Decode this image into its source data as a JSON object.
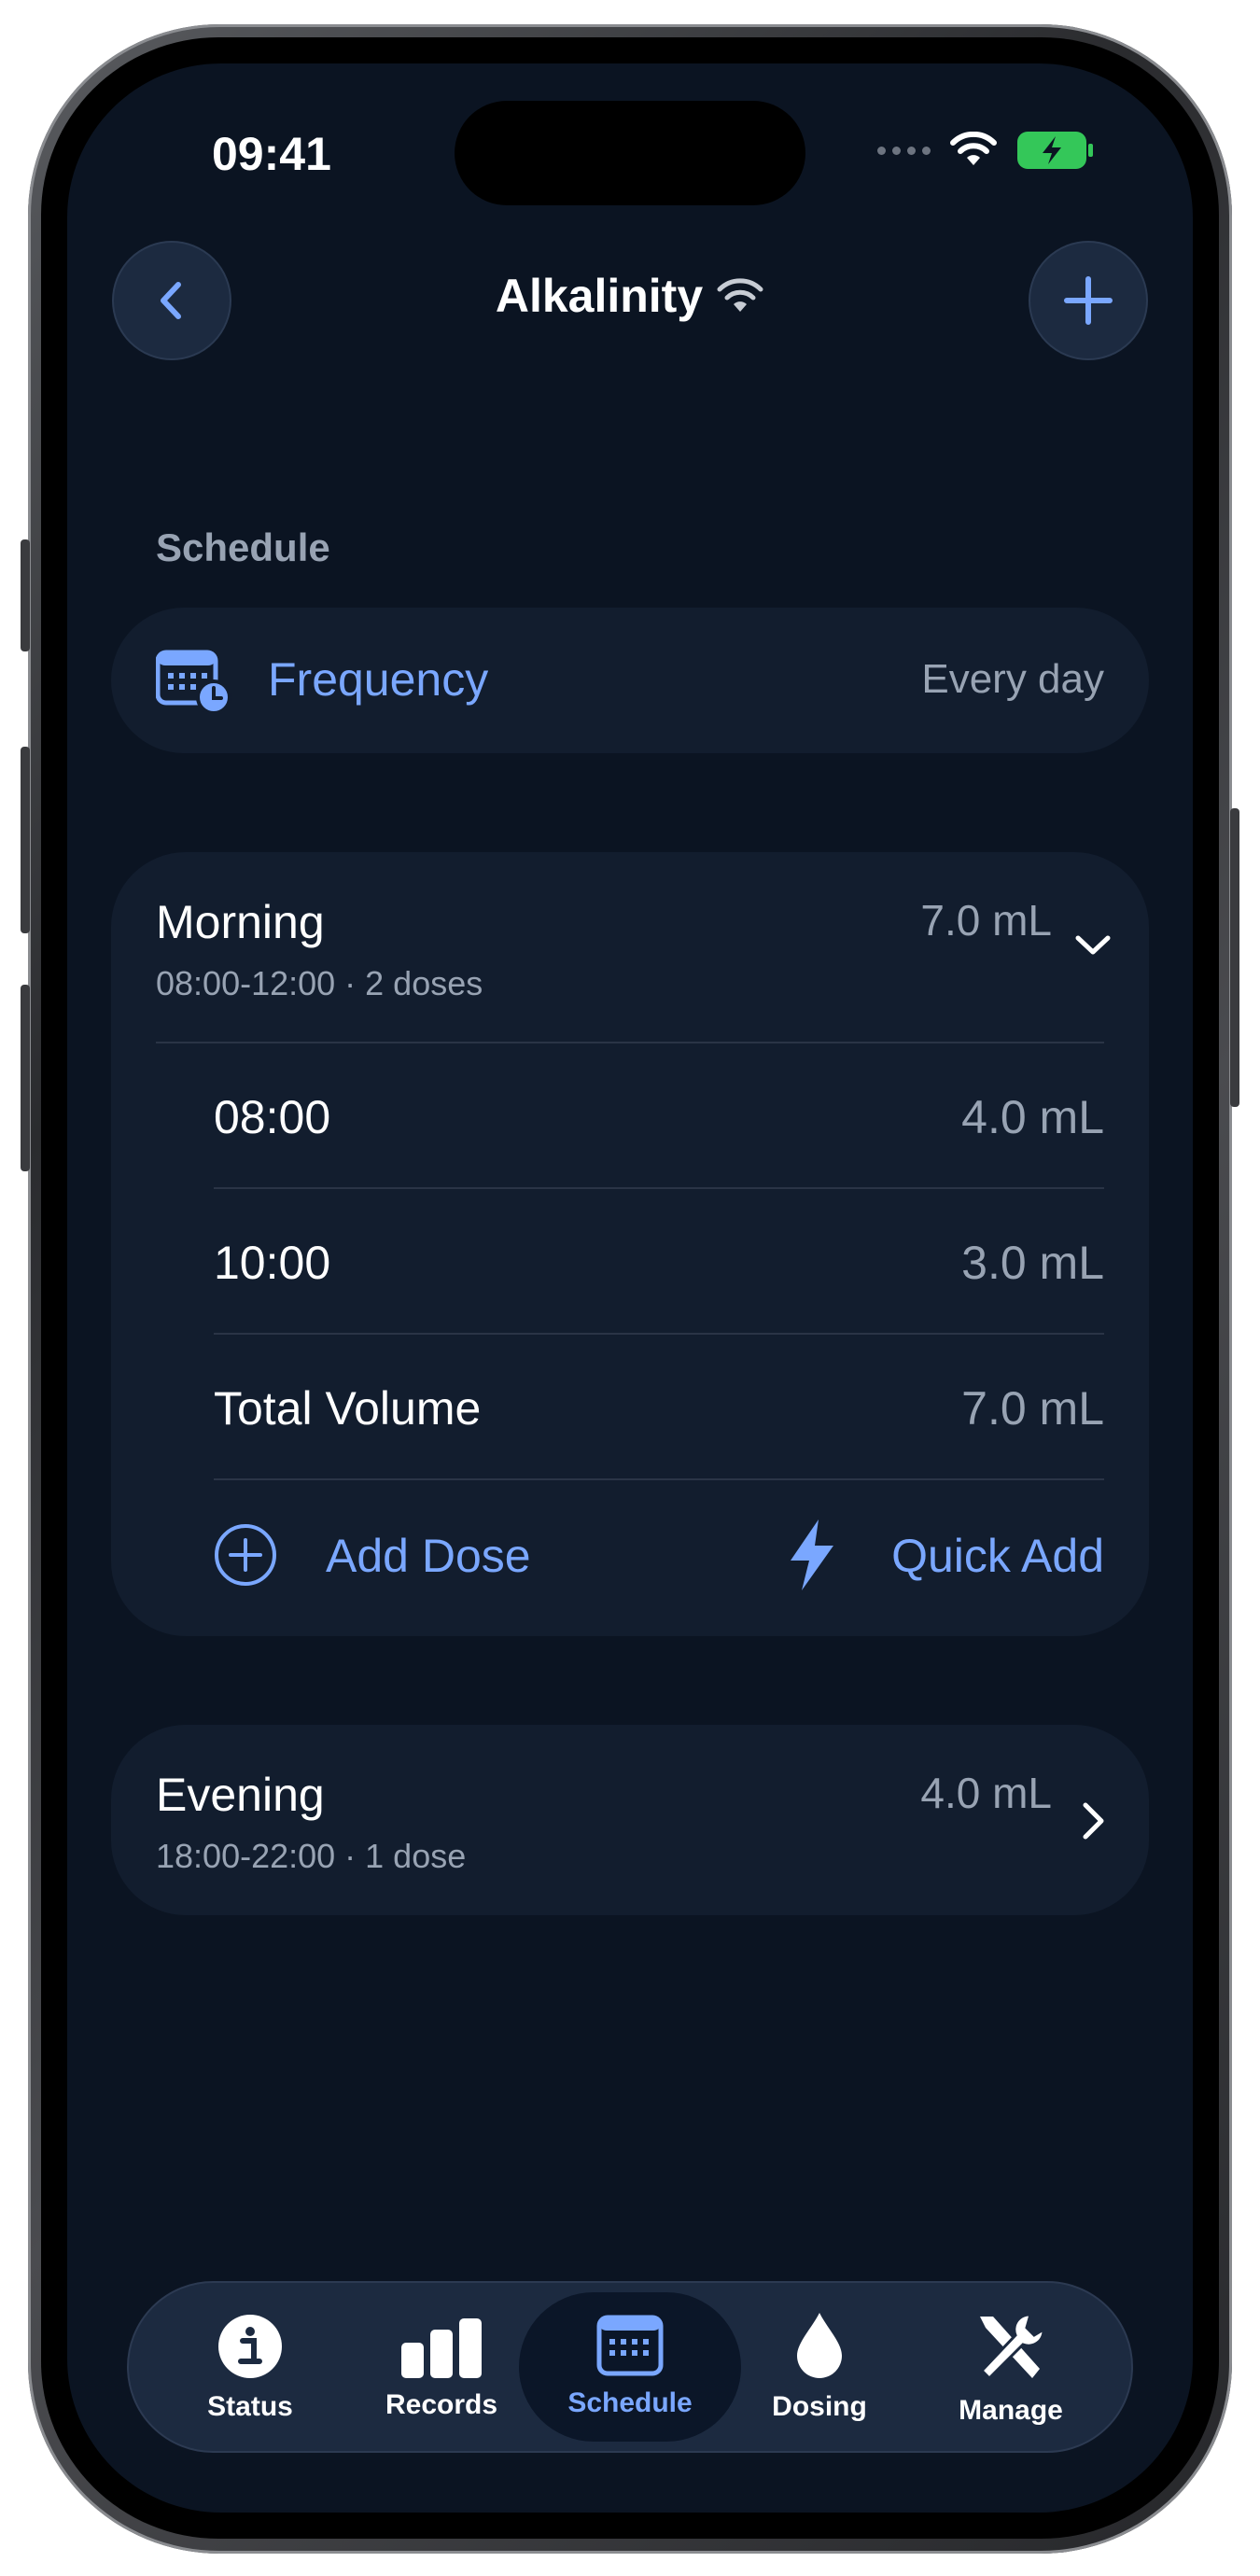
{
  "status_bar": {
    "time": "09:41"
  },
  "header": {
    "title": "Alkalinity"
  },
  "schedule": {
    "section_label": "Schedule",
    "frequency": {
      "label": "Frequency",
      "value": "Every day"
    }
  },
  "morning": {
    "name": "Morning",
    "subtitle": "08:00-12:00 · 2 doses",
    "total": "7.0 mL",
    "doses": [
      {
        "time": "08:00",
        "volume": "4.0 mL"
      },
      {
        "time": "10:00",
        "volume": "3.0 mL"
      }
    ],
    "total_label": "Total Volume",
    "total_value": "7.0 mL",
    "add_dose_label": "Add Dose",
    "quick_add_label": "Quick Add"
  },
  "evening": {
    "name": "Evening",
    "subtitle": "18:00-22:00 · 1 dose",
    "total": "4.0 mL"
  },
  "tabs": [
    {
      "label": "Status",
      "icon": "info-icon"
    },
    {
      "label": "Records",
      "icon": "bar-chart-icon"
    },
    {
      "label": "Schedule",
      "icon": "calendar-icon",
      "active": true
    },
    {
      "label": "Dosing",
      "icon": "drop-icon"
    },
    {
      "label": "Manage",
      "icon": "tools-icon"
    }
  ],
  "colors": {
    "background": "#0b1422",
    "card": "#121d2e",
    "accent": "#7aa7ff",
    "battery": "#34c759"
  }
}
